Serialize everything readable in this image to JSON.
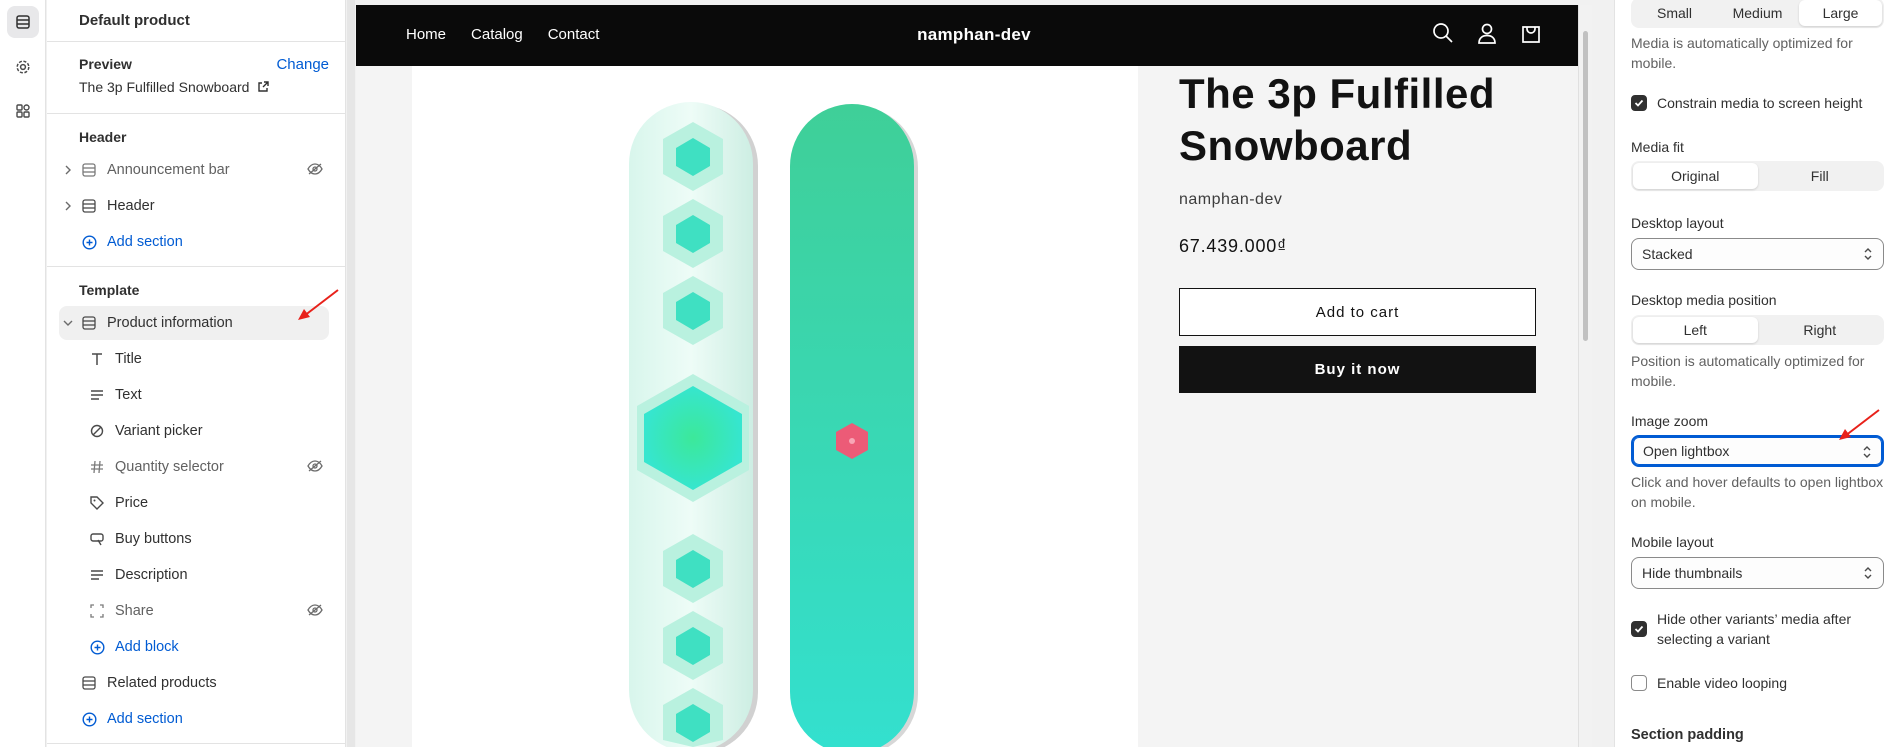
{
  "sidebar": {
    "title": "Default product",
    "preview": {
      "label": "Preview",
      "change": "Change",
      "value": "The 3p Fulfilled Snowboard"
    },
    "header_group": {
      "label": "Header",
      "items": [
        {
          "label": "Announcement bar",
          "icon": "section-icon",
          "hidden": true
        },
        {
          "label": "Header",
          "icon": "section-icon",
          "hidden": false
        }
      ],
      "add_section": "Add section"
    },
    "template_group": {
      "label": "Template",
      "section": "Product information",
      "blocks": [
        {
          "label": "Title",
          "icon": "title-icon"
        },
        {
          "label": "Text",
          "icon": "text-icon"
        },
        {
          "label": "Variant picker",
          "icon": "variant-icon"
        },
        {
          "label": "Quantity selector",
          "icon": "hash-icon"
        },
        {
          "label": "Price",
          "icon": "price-icon"
        },
        {
          "label": "Buy buttons",
          "icon": "buy-icon"
        },
        {
          "label": "Description",
          "icon": "text-icon"
        },
        {
          "label": "Share",
          "icon": "share-icon"
        }
      ],
      "add_block": "Add block",
      "related": "Related products",
      "add_section": "Add section"
    }
  },
  "store": {
    "nav": [
      "Home",
      "Catalog",
      "Contact"
    ],
    "name": "namphan-dev",
    "product_title": "The 3p Fulfilled Snowboard",
    "vendor": "namphan-dev",
    "price": "67.439.000₫",
    "add_to_cart": "Add to cart",
    "buy_now": "Buy it now"
  },
  "settings": {
    "media_size": {
      "options": [
        "Small",
        "Medium",
        "Large"
      ],
      "selected": "Large"
    },
    "media_size_help": "Media is automatically optimized for mobile.",
    "constrain": {
      "label": "Constrain media to screen height",
      "checked": true
    },
    "media_fit": {
      "label": "Media fit",
      "options": [
        "Original",
        "Fill"
      ],
      "selected": "Original"
    },
    "desktop_layout": {
      "label": "Desktop layout",
      "value": "Stacked"
    },
    "desktop_media_position": {
      "label": "Desktop media position",
      "options": [
        "Left",
        "Right"
      ],
      "selected": "Left"
    },
    "position_help": "Position is automatically optimized for mobile.",
    "image_zoom": {
      "label": "Image zoom",
      "value": "Open lightbox"
    },
    "zoom_help": "Click and hover defaults to open lightbox on mobile.",
    "mobile_layout": {
      "label": "Mobile layout",
      "value": "Hide thumbnails"
    },
    "hide_variants": {
      "label": "Hide other variants’ media after selecting a variant",
      "checked": true
    },
    "video_loop": {
      "label": "Enable video looping",
      "checked": false
    },
    "section_padding": "Section padding"
  },
  "colors": {
    "accent": "#005bd3",
    "annotation": "#e8211a",
    "board": "#3fd6b4"
  }
}
